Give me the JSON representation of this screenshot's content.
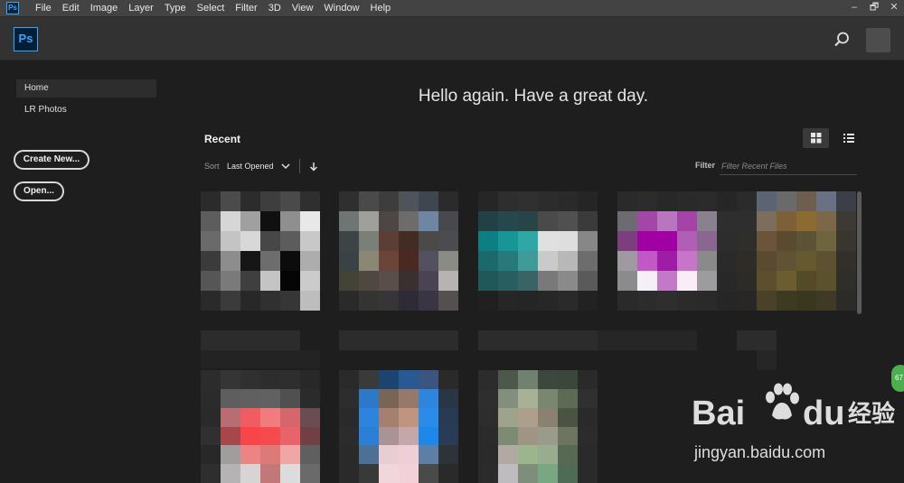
{
  "app": {
    "logo_text": "Ps",
    "menu_logo_text": "Ps"
  },
  "menu": [
    "File",
    "Edit",
    "Image",
    "Layer",
    "Type",
    "Select",
    "Filter",
    "3D",
    "View",
    "Window",
    "Help"
  ],
  "window_controls": [
    "–",
    "🗗",
    "✕"
  ],
  "sidebar": {
    "items": [
      {
        "label": "Home"
      },
      {
        "label": "LR Photos"
      }
    ],
    "create_new": "Create New...",
    "open": "Open..."
  },
  "main": {
    "greeting": "Hello again. Have a great day.",
    "recent_title": "Recent",
    "sort_label": "Sort",
    "sort_value": "Last Opened",
    "filter_label": "Filter",
    "filter_placeholder": "Filter Recent Files"
  },
  "watermark": {
    "brand": "Bai",
    "brand2": "du",
    "cn": "经验",
    "url": "jingyan.baidu.com",
    "badge": "67"
  },
  "colors": {
    "accent": "#31a8ff",
    "background": "#1e1e1e",
    "header": "#323232"
  },
  "icons": [
    "search-icon",
    "grid-view-icon",
    "list-view-icon",
    "chevron-down-icon",
    "arrow-down-icon",
    "paw-icon"
  ],
  "thumbnails": [
    {
      "name": "recent-file-1",
      "cols": 6,
      "colors": [
        "#2b2b2b",
        "#4b4b4b",
        "#2c2c2c",
        "#3e3e3e",
        "#4a4a4a",
        "#2f2f2f",
        "#5d5d5d",
        "#d6d6d6",
        "#a0a0a0",
        "#101010",
        "#8f8f8f",
        "#e8e8e8",
        "#6a6a6a",
        "#c4c4c4",
        "#d8d8d8",
        "#474747",
        "#5c5c5c",
        "#c8c8c8",
        "#3b3b3b",
        "#8d8d8d",
        "#161616",
        "#6d6d6d",
        "#0c0c0c",
        "#adadad",
        "#565656",
        "#7a7a7a",
        "#3f3f3f",
        "#c4c4c4",
        "#050505",
        "#cbcbcb",
        "#2a2a2a",
        "#3b3b3b",
        "#282828",
        "#303030",
        "#363636",
        "#bdbdbd"
      ]
    },
    {
      "name": "recent-file-2",
      "cols": 6,
      "colors": [
        "#2f2f2f",
        "#4a4a4a",
        "#3d3d3d",
        "#4e545a",
        "#3e4650",
        "#2b2b2b",
        "#6f7575",
        "#9f9f9b",
        "#4d4645",
        "#6d6c6a",
        "#6f86a3",
        "#47494e",
        "#3e4345",
        "#7a8077",
        "#5d3e37",
        "#432c24",
        "#4b4a48",
        "#4a4c50",
        "#3a4245",
        "#8b8775",
        "#6b4638",
        "#4a2a20",
        "#535060",
        "#8b8b85",
        "#434338",
        "#4f4840",
        "#5a4e4a",
        "#3b3030",
        "#4a4352",
        "#b6b3b2",
        "#2a2a2a",
        "#343430",
        "#383538",
        "#2d2b35",
        "#3a3545",
        "#555050"
      ]
    },
    {
      "name": "recent-file-3",
      "cols": 6,
      "colors": [
        "#262626",
        "#2e2e2e",
        "#303030",
        "#2c2c2c",
        "#2a2a2a",
        "#252525",
        "#224145",
        "#25484c",
        "#284446",
        "#4a4a4a",
        "#505050",
        "#3b3b3b",
        "#0b8082",
        "#189596",
        "#2fa8a5",
        "#e0e0e0",
        "#dedede",
        "#878787",
        "#1b6a6b",
        "#28797a",
        "#3e9b99",
        "#cacaca",
        "#b8b8b8",
        "#6d6d6d",
        "#20585a",
        "#285e60",
        "#3a6366",
        "#797979",
        "#8a8a8a",
        "#5a5a5a",
        "#202020",
        "#262626",
        "#252525",
        "#272727",
        "#2a2a2a",
        "#222222"
      ]
    },
    {
      "name": "recent-file-4",
      "cols": 6,
      "colors": [
        "#2a2a2a",
        "#2c2c2c",
        "#282828",
        "#2a2a2a",
        "#2b2b2b",
        "#262626",
        "#6d6a72",
        "#a346a8",
        "#b975c0",
        "#a443a8",
        "#8a8190",
        "#2e2e2e",
        "#7a3f7c",
        "#a100a3",
        "#a000a4",
        "#b15eb7",
        "#8a6790",
        "#2d2d2d",
        "#9e9a9f",
        "#c257c8",
        "#9f1ca6",
        "#c874cb",
        "#8a8a8a",
        "#2a2a2a",
        "#8c8b8c",
        "#f5f0f5",
        "#c37ac6",
        "#f8eef8",
        "#9c9b9d",
        "#282828",
        "#2a2a2a",
        "#2c2c2c",
        "#2e2e2e",
        "#2b2b2b",
        "#2a2a2a",
        "#262626"
      ]
    },
    {
      "name": "recent-file-5",
      "cols": 6,
      "colors": [
        "#2b2b2b",
        "#5c6372",
        "#6a6a6a",
        "#6e5e4d",
        "#6a7183",
        "#3b4048",
        "#2e2e2e",
        "#7d6d5e",
        "#7e6038",
        "#8b6b30",
        "#7c6848",
        "#3d3a35",
        "#302e2b",
        "#6b543a",
        "#5a4b30",
        "#5c5236",
        "#6e643e",
        "#393630",
        "#2f2c28",
        "#594a30",
        "#5e5334",
        "#66582f",
        "#5c5130",
        "#33302b",
        "#2d2b27",
        "#5d4e2e",
        "#6b5d2f",
        "#534a28",
        "#5b512c",
        "#302e2a",
        "#292725",
        "#4a4228",
        "#3d3a22",
        "#3a371f",
        "#3f3a25",
        "#2d2b28"
      ]
    },
    {
      "name": "recent-file-6",
      "cols": 6,
      "colors": [
        "#2c2c2c",
        "#353535",
        "#303030",
        "#2d2d2d",
        "#2e2e2e",
        "#282828",
        "#2b2b2b",
        "#5e5e5e",
        "#606060",
        "#616161",
        "#505050",
        "#2b2b2b",
        "#2a2a2a",
        "#b86d72",
        "#f05c62",
        "#f17c7e",
        "#d5676c",
        "#6a4c51",
        "#303030",
        "#a8474a",
        "#f7454a",
        "#f54a4e",
        "#e9636a",
        "#704045",
        "#282828",
        "#a09e9c",
        "#ec8486",
        "#dc7979",
        "#f1a6a6",
        "#5f5f5f",
        "#2e2e2e",
        "#b6b3b4",
        "#d7d4d4",
        "#c27878",
        "#dcdcdc",
        "#6a6a6a"
      ]
    },
    {
      "name": "recent-file-7",
      "cols": 6,
      "colors": [
        "#2a2a2a",
        "#3a3a3a",
        "#1c4470",
        "#275a94",
        "#3b5580",
        "#2a2a2a",
        "#2d2d2d",
        "#2c78c9",
        "#7a6453",
        "#98786a",
        "#2f84dd",
        "#2a3646",
        "#2a2a2a",
        "#2d83dd",
        "#a6806e",
        "#c09580",
        "#2a8be8",
        "#293a53",
        "#2c2c2c",
        "#2b7fd6",
        "#aa9395",
        "#c3a7aa",
        "#1f87e9",
        "#2a3b55",
        "#2a2a2a",
        "#4e6f96",
        "#e8ced2",
        "#edcfd5",
        "#5d7fa6",
        "#2e3239",
        "#2a2a2a",
        "#393939",
        "#f1d6dc",
        "#f2d2d8",
        "#4a4a4a",
        "#2a2a2a"
      ]
    },
    {
      "name": "recent-file-8",
      "cols": 6,
      "colors": [
        "#2c2c2c",
        "#4c584b",
        "#718170",
        "#3e473d",
        "#3c473b",
        "#2a2a2a",
        "#2e2e2e",
        "#848e7c",
        "#a8b195",
        "#7a8770",
        "#5f6a55",
        "#303030",
        "#2d2d2d",
        "#9ea48c",
        "#ae9f8d",
        "#8b8170",
        "#4b5343",
        "#2a2a2a",
        "#2b2b2b",
        "#7e8b74",
        "#a09585",
        "#9b9b8c",
        "#6d7460",
        "#2c2c2c",
        "#2a2a2a",
        "#b2a9a2",
        "#9bb58d",
        "#9aac8e",
        "#576952",
        "#2a2a2a",
        "#2b2b2b",
        "#c0bac1",
        "#7d8f7a",
        "#79a683",
        "#4d6b55",
        "#2a2a2a"
      ]
    }
  ]
}
